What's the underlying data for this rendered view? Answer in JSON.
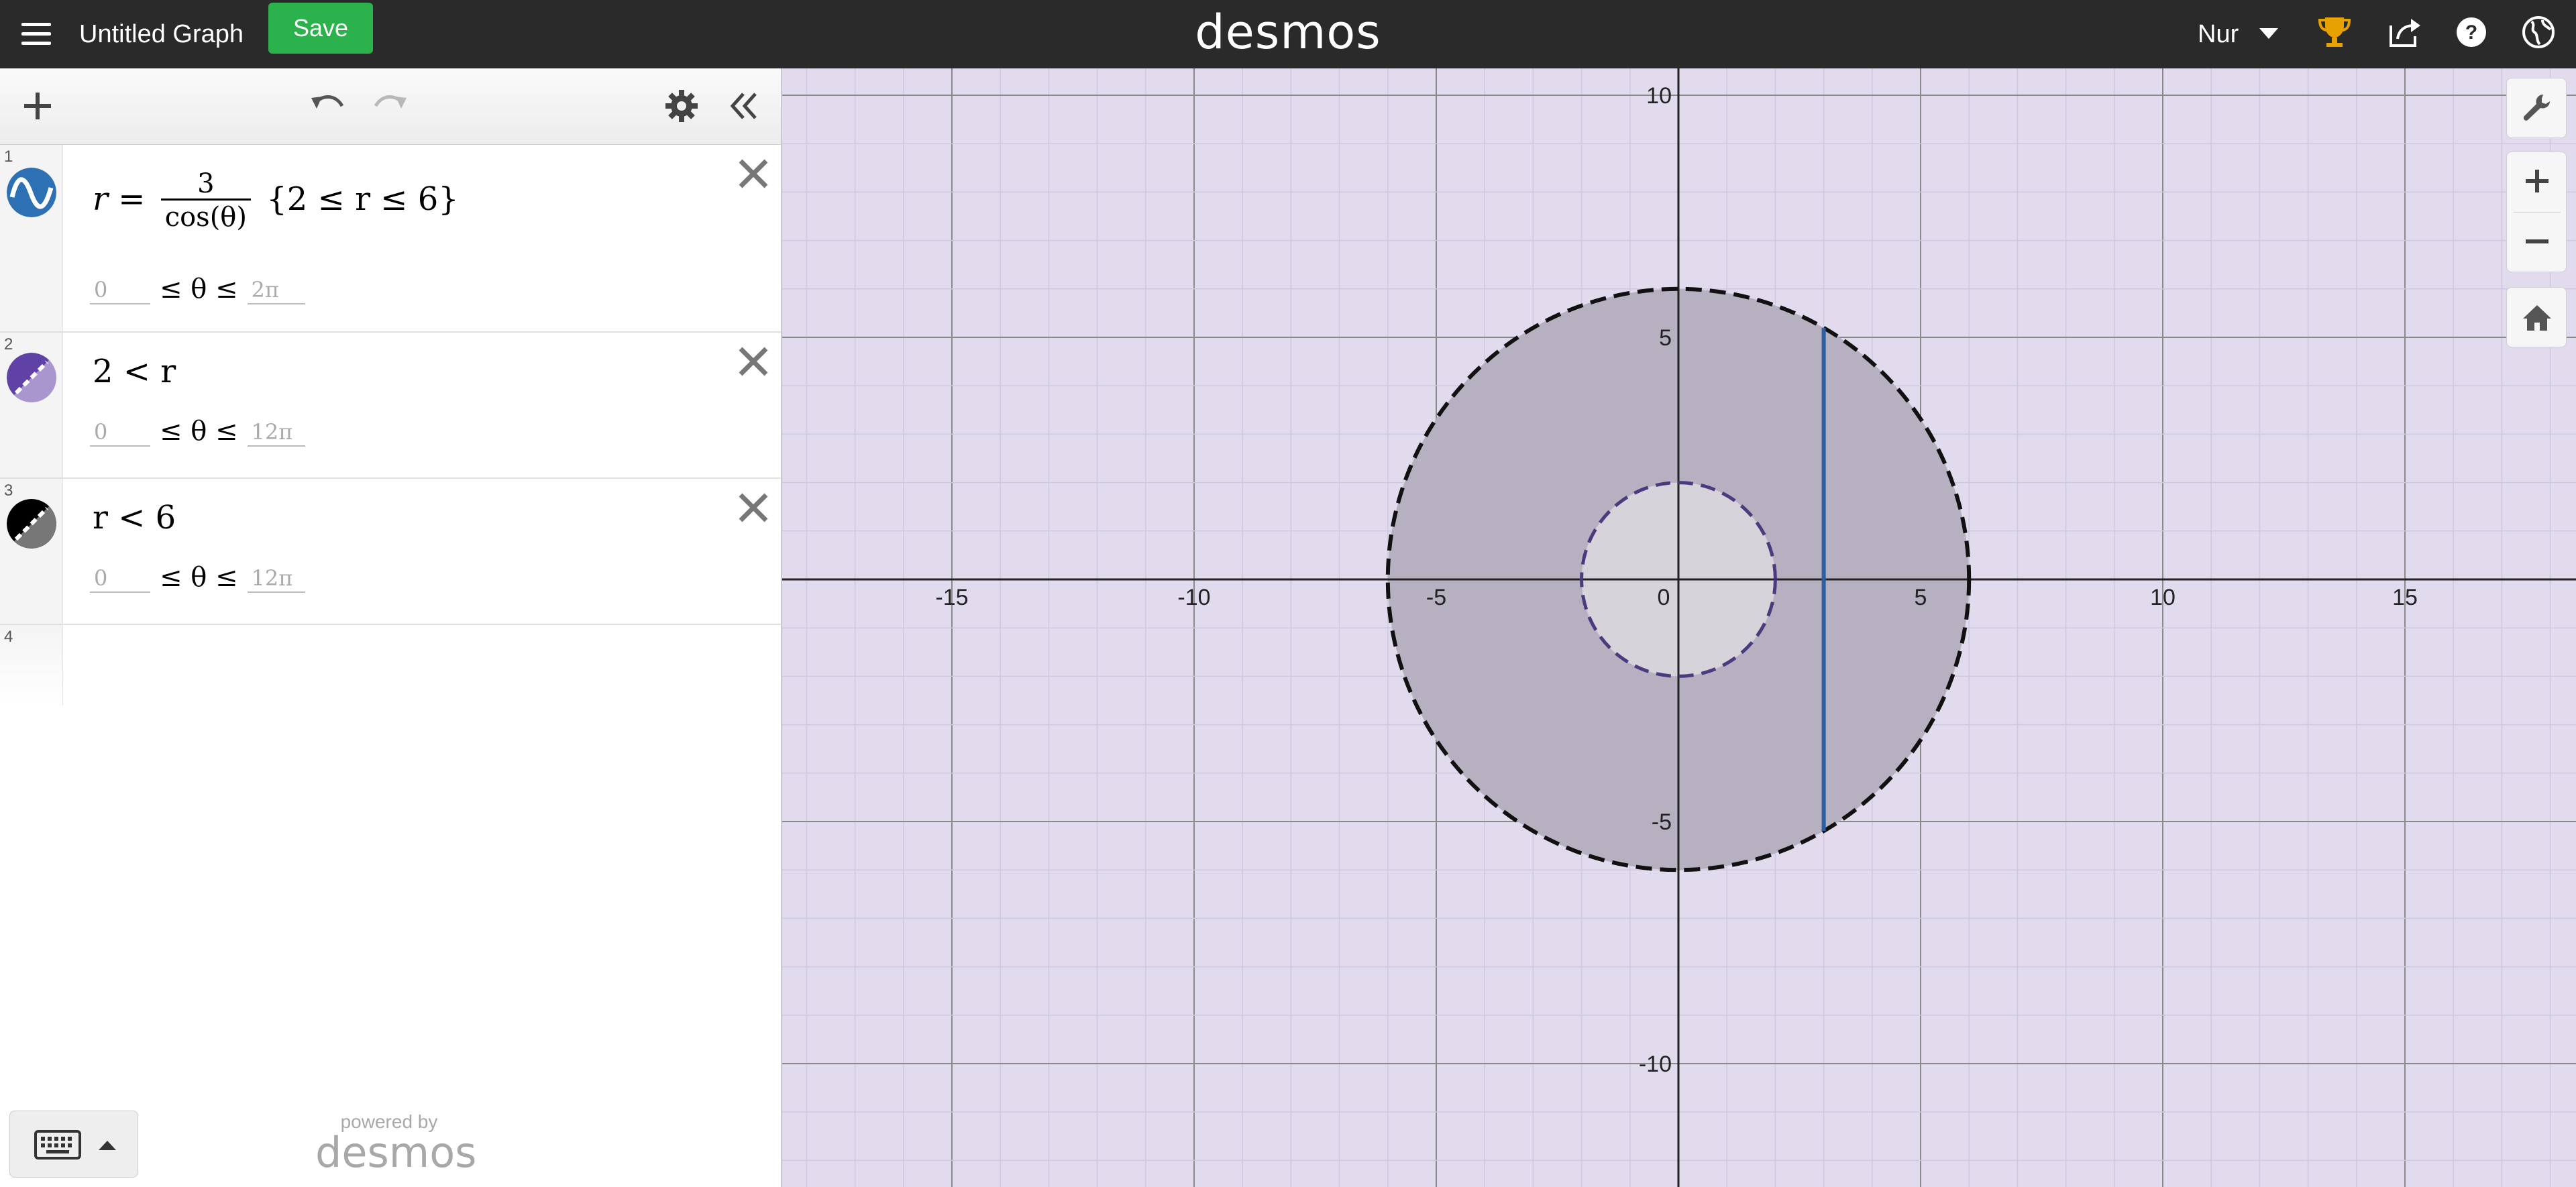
{
  "app": {
    "title": "Untitled Graph",
    "save_label": "Save",
    "brand": "desmos",
    "user_name": "Nur"
  },
  "icons": {
    "menu": "hamburger-menu-icon",
    "user_caret": "caret-down-icon",
    "trophy": "trophy-icon",
    "share": "share-icon",
    "help": "help-icon",
    "language": "globe-icon",
    "add": "plus-icon",
    "undo": "undo-icon",
    "redo": "redo-icon",
    "settings": "gear-icon",
    "collapse": "double-chevron-left-icon",
    "wrench": "wrench-icon",
    "zoom_in": "plus-icon",
    "zoom_out": "minus-icon",
    "home": "home-icon",
    "keyboard": "keyboard-icon"
  },
  "expressions": [
    {
      "number": "1",
      "lhs": "r =",
      "numerator": "3",
      "denominator": "cos(θ)",
      "restriction": "{2 ≤ r ≤ 6}",
      "theta_min_placeholder": "0",
      "theta_max_placeholder": "2π",
      "theta_mid": "≤ θ ≤",
      "color": "#2d70b3",
      "style": "solid"
    },
    {
      "number": "2",
      "text": "2 < r",
      "theta_min_placeholder": "0",
      "theta_max_placeholder": "12π",
      "theta_mid": "≤ θ ≤",
      "color": "#6042a6",
      "style": "dashed"
    },
    {
      "number": "3",
      "text": "r < 6",
      "theta_min_placeholder": "0",
      "theta_max_placeholder": "12π",
      "theta_mid": "≤ θ ≤",
      "color": "#000000",
      "style": "dashed"
    },
    {
      "number": "4"
    }
  ],
  "powered_by": {
    "line1": "powered by",
    "line2": "desmos"
  },
  "graph": {
    "x_range": [
      -18,
      18
    ],
    "y_range": [
      -12.3,
      10.6
    ],
    "x_ticks": [
      "-15",
      "-10",
      "-5",
      "0",
      "5",
      "10",
      "15"
    ],
    "y_ticks": [
      "10",
      "5",
      "-5",
      "-10"
    ],
    "outer_radius": 6,
    "inner_radius": 2,
    "vertical_line_x": 3,
    "colors": {
      "background": "#e1dbed",
      "minor_grid": "#cfc8de",
      "major_grid": "#8a8a8a",
      "axis": "#222222",
      "ring_fill": "#b7b0c0",
      "inner_fill": "#d6d3da",
      "inner_circle": "#4b3a7e",
      "outer_circle": "#111111",
      "vertical_line": "#2d5fa0"
    }
  }
}
